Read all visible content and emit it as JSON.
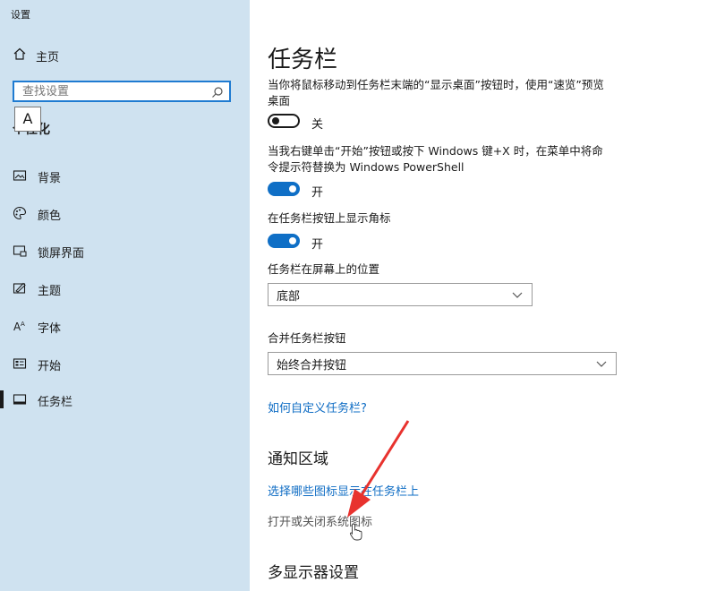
{
  "window": {
    "title": "设置"
  },
  "sidebar": {
    "home_label": "主页",
    "search_placeholder": "查找设置",
    "ime_indicator": "A",
    "section_label": "个性化",
    "items": [
      {
        "label": "背景",
        "icon": "picture-icon"
      },
      {
        "label": "颜色",
        "icon": "palette-icon"
      },
      {
        "label": "锁屏界面",
        "icon": "lock-screen-icon"
      },
      {
        "label": "主题",
        "icon": "theme-icon"
      },
      {
        "label": "字体",
        "icon": "font-icon"
      },
      {
        "label": "开始",
        "icon": "start-icon"
      },
      {
        "label": "任务栏",
        "icon": "taskbar-icon",
        "active": true
      }
    ]
  },
  "main": {
    "title": "任务栏",
    "settings": [
      {
        "text": "当你将鼠标移动到任务栏末端的“显示桌面”按钮时，使用“速览”预览桌面",
        "state": "关",
        "on": false
      },
      {
        "text": "当我右键单击“开始”按钮或按下 Windows 键+X 时，在菜单中将命令提示符替换为 Windows PowerShell",
        "state": "开",
        "on": true
      },
      {
        "text": "在任务栏按钮上显示角标",
        "state": "开",
        "on": true
      }
    ],
    "position": {
      "label": "任务栏在屏幕上的位置",
      "value": "底部"
    },
    "combine": {
      "label": "合并任务栏按钮",
      "value": "始终合并按钮"
    },
    "customize_link": "如何自定义任务栏?",
    "notification": {
      "heading": "通知区域",
      "link1": "选择哪些图标显示在任务栏上",
      "link2": "打开或关闭系统图标"
    },
    "multi_display_heading": "多显示器设置"
  },
  "colors": {
    "accent": "#0f6fc6",
    "sidebar_bg": "#cfe2f0",
    "annotation": "#e8322e"
  }
}
